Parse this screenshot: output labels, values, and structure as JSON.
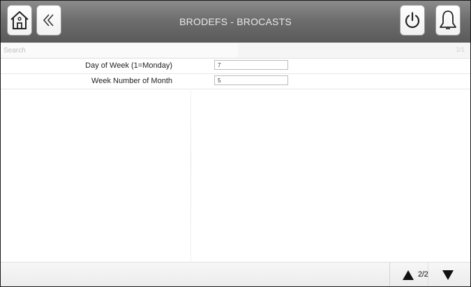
{
  "header": {
    "title": "BRODEFS - BROCASTS",
    "icons": {
      "home": "home-icon",
      "back": "double-chevron-left-icon",
      "power": "power-icon",
      "alarm": "bell-icon"
    }
  },
  "search": {
    "placeholder": "Search",
    "count": "1/1"
  },
  "fields": [
    {
      "label": "Day of Week (1=Monday)",
      "value": "7"
    },
    {
      "label": "Week Number of Month",
      "value": "5"
    }
  ],
  "footer": {
    "page_indicator": "2/2",
    "icons": {
      "prev": "triangle-up-icon",
      "next": "triangle-down-icon"
    }
  }
}
